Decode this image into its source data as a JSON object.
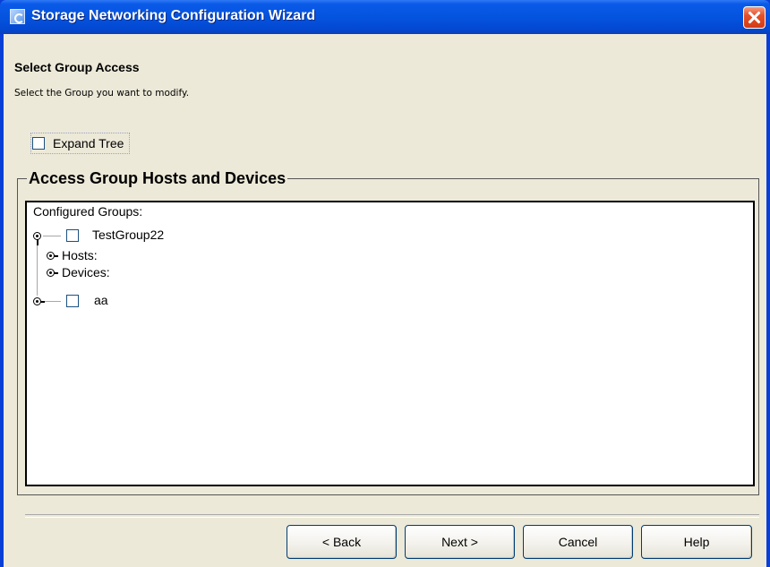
{
  "window": {
    "title": "Storage Networking Configuration Wizard"
  },
  "page": {
    "title": "Select Group Access",
    "subtitle": "Select the Group you want to modify."
  },
  "expand_tree": {
    "label": "Expand Tree",
    "checked": false
  },
  "group_box": {
    "title": "Access Group Hosts and Devices",
    "tree": {
      "header": "Configured Groups:",
      "nodes": [
        {
          "label": "TestGroup22",
          "checked": false,
          "expanded": true,
          "children": [
            {
              "label": "Hosts:"
            },
            {
              "label": "Devices:"
            }
          ]
        },
        {
          "label": "aa",
          "checked": false,
          "expanded": false
        }
      ]
    }
  },
  "buttons": {
    "back": "< Back",
    "next": "Next >",
    "cancel": "Cancel",
    "help": "Help"
  }
}
